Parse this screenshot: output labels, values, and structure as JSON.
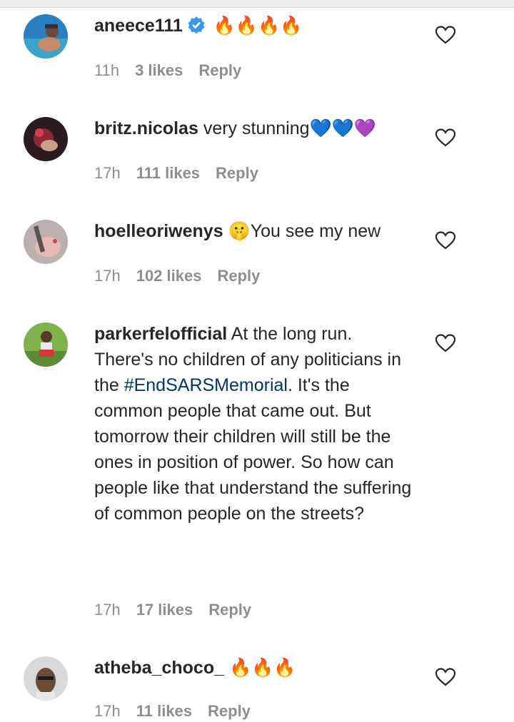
{
  "comments": [
    {
      "username": "aneece111",
      "verified": true,
      "text": " 🔥🔥🔥🔥",
      "time": "11h",
      "likes": "3 likes",
      "reply": "Reply"
    },
    {
      "username": "britz.nicolas",
      "text": " very stunning💙💙💜",
      "time": "17h",
      "likes": "111 likes",
      "reply": "Reply"
    },
    {
      "username": "hoelleoriwenys",
      "text": " 🤫You see my new",
      "time": "17h",
      "likes": "102 likes",
      "reply": "Reply"
    },
    {
      "username": "parkerfelofficial",
      "text_before": " At the long run. There's no children of any politicians in the ",
      "hashtag": "#EndSARSMemorial",
      "text_after": ". It's the common people that came out. But tomorrow their children will still be the ones in position of power. So how can people like that understand the suffering of common people on the streets?",
      "time": "17h",
      "likes": "17 likes",
      "reply": "Reply"
    },
    {
      "username": "atheba_choco_",
      "text": " 🔥🔥🔥",
      "time": "17h",
      "likes": "11 likes",
      "reply": "Reply"
    }
  ],
  "icons": {
    "heart": "heart-outline-icon",
    "verified": "verified-badge-icon"
  },
  "colors": {
    "hashtag": "#00376b",
    "meta": "#8e8e8e",
    "verified": "#3897f0"
  }
}
